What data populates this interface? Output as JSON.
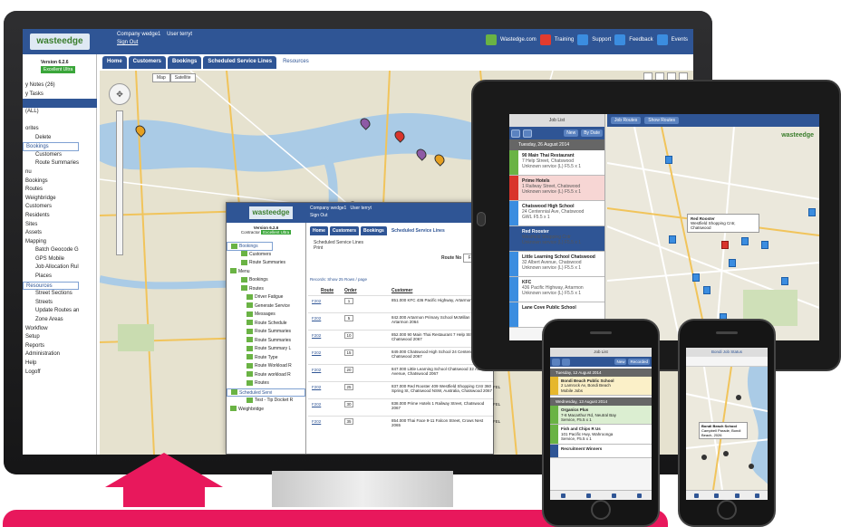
{
  "app": {
    "logo": "wasteedge",
    "company_label": "Company",
    "company_value": "wedge1",
    "user_label": "User",
    "user_value": "terryt",
    "signout": "Sign Out",
    "version": "Version 6.2.6",
    "edition": "Excellent Ultra",
    "links": [
      "Wastedge.com",
      "Training",
      "Support",
      "Feedback",
      "Events"
    ]
  },
  "tabs": [
    "Home",
    "Customers",
    "Bookings",
    "Scheduled Service Lines",
    "Resources"
  ],
  "map": {
    "toggle": [
      "Map",
      "Satellite"
    ]
  },
  "sidebar": {
    "items": [
      {
        "label": "y Notes (26)",
        "style": ""
      },
      {
        "label": "y Tasks",
        "style": ""
      },
      {
        "label": "",
        "style": "hl"
      },
      {
        "label": "(ALL)",
        "style": ""
      },
      {
        "label": "",
        "style": ""
      },
      {
        "label": "orites",
        "style": ""
      },
      {
        "label": "Delete",
        "style": "ind"
      },
      {
        "label": "Bookings",
        "style": "outline"
      },
      {
        "label": "Customers",
        "style": "ind"
      },
      {
        "label": "Route Summaries",
        "style": "ind"
      },
      {
        "label": "nu",
        "style": ""
      },
      {
        "label": "Bookings",
        "style": ""
      },
      {
        "label": "Routes",
        "style": ""
      },
      {
        "label": "Weighbridge",
        "style": ""
      },
      {
        "label": "Customers",
        "style": ""
      },
      {
        "label": "Residents",
        "style": ""
      },
      {
        "label": "Sites",
        "style": ""
      },
      {
        "label": "Assets",
        "style": ""
      },
      {
        "label": "Mapping",
        "style": ""
      },
      {
        "label": "Batch Geocode G",
        "style": "ind"
      },
      {
        "label": "GPS Mobile",
        "style": "ind"
      },
      {
        "label": "Job Allocation Rul",
        "style": "ind"
      },
      {
        "label": "Places",
        "style": "ind"
      },
      {
        "label": "Resources",
        "style": "outline"
      },
      {
        "label": "Street Sections",
        "style": "ind"
      },
      {
        "label": "Streets",
        "style": "ind"
      },
      {
        "label": "Update Routes an",
        "style": "ind"
      },
      {
        "label": "Zone Areas",
        "style": "ind"
      },
      {
        "label": "Workflow",
        "style": ""
      },
      {
        "label": "Setup",
        "style": ""
      },
      {
        "label": "Reports",
        "style": ""
      },
      {
        "label": "Administration",
        "style": ""
      },
      {
        "label": "Help",
        "style": ""
      },
      {
        "label": "Logoff",
        "style": ""
      }
    ]
  },
  "popup": {
    "logo": "wasteedge",
    "company_label": "Company",
    "company_value": "wedge1",
    "user_label": "User",
    "user_value": "terryt",
    "signout": "Sign Out",
    "version": "Version 6.2.6",
    "contractor": "Contractor",
    "edition": "Excellent Ultra",
    "tabs": [
      "Home",
      "Customers",
      "Bookings",
      "Scheduled Service Lines"
    ],
    "subtitle": "Scheduled Service Lines",
    "print": "Print",
    "route_no_label": "Route No",
    "route_no_value": "F202",
    "records": "Records: Show 25 Rows / page",
    "headers": [
      "Route",
      "Order",
      "Customer"
    ],
    "side_items": [
      {
        "label": "Bookings",
        "style": "sel"
      },
      {
        "label": "Customers",
        "style": "ind"
      },
      {
        "label": "Route Summaries",
        "style": "ind"
      },
      {
        "label": "Menu",
        "style": ""
      },
      {
        "label": "Bookings",
        "style": "ind"
      },
      {
        "label": "Routes",
        "style": "ind"
      },
      {
        "label": "Driver Fatigue",
        "style": "ind2"
      },
      {
        "label": "Generate Service",
        "style": "ind2"
      },
      {
        "label": "Messages",
        "style": "ind2"
      },
      {
        "label": "Route Schedule",
        "style": "ind2"
      },
      {
        "label": "Route Summaries",
        "style": "ind2"
      },
      {
        "label": "Route Summaries",
        "style": "ind2"
      },
      {
        "label": "Route Summary L",
        "style": "ind2"
      },
      {
        "label": "Route Type",
        "style": "ind2"
      },
      {
        "label": "Route Workload R",
        "style": "ind2"
      },
      {
        "label": "Route workload R",
        "style": "ind2"
      },
      {
        "label": "Routes",
        "style": "ind2"
      },
      {
        "label": "Scheduled Servi",
        "style": "sel2"
      },
      {
        "label": "Test - Tip Docket R",
        "style": "ind2"
      },
      {
        "label": "Weighbridge",
        "style": ""
      }
    ],
    "rows": [
      {
        "route": "F202",
        "order": "1",
        "customer": "851.000 KFC 436 Pacific Highway, Artarmon 2064",
        "fel": ""
      },
      {
        "route": "F202",
        "order": "5",
        "customer": "842.000 Artarmon Primary School McMillan Road, Artarmon 2064",
        "fel": ""
      },
      {
        "route": "F202",
        "order": "10",
        "customer": "852.000 90 Main Thai Restaurant 7 Help Street, Chatswood 2067",
        "fel": ""
      },
      {
        "route": "F202",
        "order": "15",
        "customer": "849.000 Chatswood High School 24 Centennial Avenue, Chatswood 2067",
        "fel": ""
      },
      {
        "route": "F202",
        "order": "20",
        "customer": "847.000 Little Learning School Chatswood 32 Albert Avenue, Chatswood 2067",
        "fel": ""
      },
      {
        "route": "F202",
        "order": "25",
        "customer": "837.000 Red Rooster 409 Westfield Shopping Cntr 360 Spring St, Chatswood NSW, Australia, Chatswood 2067",
        "fel": "FEL"
      },
      {
        "route": "F202",
        "order": "30",
        "customer": "838.000 Prime Hotels 1 Railway Street, Chatswood 2067",
        "fel": "FEL"
      },
      {
        "route": "F202",
        "order": "35",
        "customer": "854.000 Thai Face 9-11 Falcon Street, Crows Nest 2065",
        "fel": "FEL"
      }
    ]
  },
  "tablet": {
    "title": "Job List",
    "buttons": [
      "New",
      "By Date"
    ],
    "map_buttons": [
      "Job Routes",
      "Show Routes"
    ],
    "logo": "wasteedge",
    "date": "Tuesday, 26 August 2014",
    "callout": "Red Rooster",
    "callout_sub": "Westfield Shopping Cntr, Chatswood",
    "cards": [
      {
        "title": "90 Main Thai Restaurant",
        "sub": "7 Help Street, Chatswood",
        "line": "Unknown service (L) F5.5 x 1",
        "color": "#6ab344",
        "bg": "#fff"
      },
      {
        "title": "Prime Hotels",
        "sub": "1 Railway Street, Chatswood",
        "line": "Unknown service (L) F5.5 x 1",
        "color": "#d9342b",
        "bg": "#f7d6d4"
      },
      {
        "title": "Chatswood High School",
        "sub": "24 Centennial Ave, Chatswood",
        "line": "GWL F5.5 x 1",
        "color": "#3b8de0",
        "bg": "#fff"
      },
      {
        "title": "Red Rooster",
        "sub": "Westfield Shopping Cntr",
        "line": "Unknown service (L) F5.5 x 1",
        "color": "#2f5595",
        "bg": "#2f5595"
      },
      {
        "title": "Little Learning School Chatswood",
        "sub": "32 Albert Avenue, Chatswood",
        "line": "Unknown service (L) F5.5 x 1",
        "color": "#3b8de0",
        "bg": "#fff"
      },
      {
        "title": "KFC",
        "sub": "436 Pacific Highway, Artarmon",
        "line": "Unknown service (L) F5.5 x 1",
        "color": "#3b8de0",
        "bg": "#fff"
      },
      {
        "title": "Lane Cove Public School",
        "sub": "",
        "line": "",
        "color": "#3b8de0",
        "bg": "#fff"
      }
    ]
  },
  "phone1": {
    "title": "Job List",
    "buttons": [
      "New",
      "Recorded"
    ],
    "dates": [
      "Tuesday, 12 August 2014",
      "Wednesday, 13 August 2014"
    ],
    "cards": [
      {
        "title": "Bondi Beach Public School",
        "sub": "2 Lamrock Av, Bondi Beach",
        "line": "Mobile Jobs",
        "color": "#e6b72c",
        "bg": "#fbf0c8"
      },
      {
        "title": "Organics Plus",
        "sub": "7-8 Macarthur Rd, Neutral Bay",
        "line": "Service, F5.5 x 1",
        "color": "#6ab344",
        "bg": "#dbeed1"
      },
      {
        "title": "Fish and Chips R Us",
        "sub": "101 Pacific Hwy, Wahroonga",
        "line": "Service, F5.5 x 1",
        "color": "#6ab344",
        "bg": "#fff"
      },
      {
        "title": "Recruitment Winners",
        "sub": "",
        "line": "",
        "color": "#2f5595",
        "bg": "#fff"
      }
    ]
  },
  "phone2": {
    "title": "Bondi Job Status",
    "callout": "Bondi Beach School",
    "callout_sub": "Campbell Parade, Bondi Beach, 2026"
  }
}
